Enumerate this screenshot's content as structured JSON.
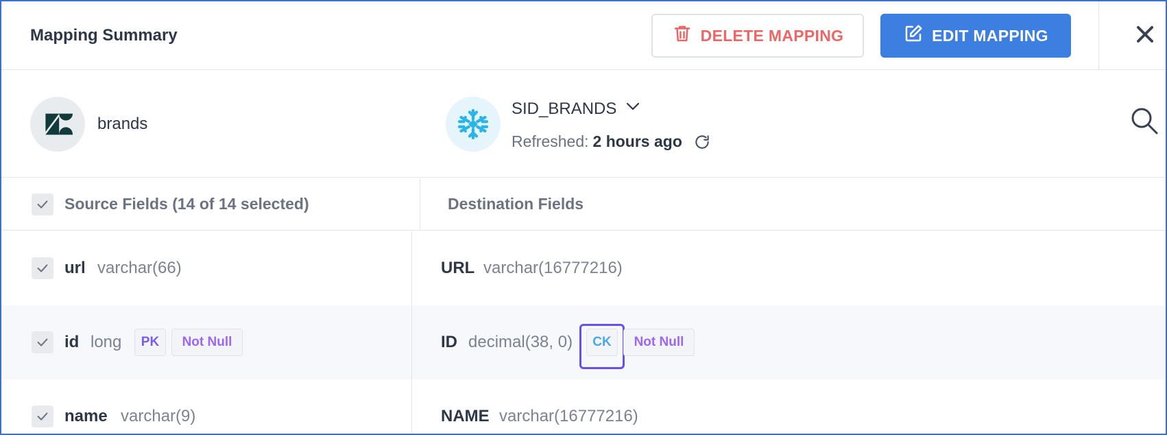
{
  "header": {
    "title": "Mapping Summary",
    "delete_label": "DELETE MAPPING",
    "edit_label": "EDIT MAPPING"
  },
  "source": {
    "name": "brands",
    "icon": "zendesk-logo"
  },
  "destination": {
    "name": "SID_BRANDS",
    "icon": "snowflake-logo",
    "refreshed_label": "Refreshed:",
    "refreshed_value": "2 hours ago"
  },
  "columns": {
    "source_header": "Source Fields (14 of 14 selected)",
    "destination_header": "Destination Fields"
  },
  "rows": [
    {
      "source_name": "url",
      "source_type": "varchar(66)",
      "source_badges": [],
      "dest_name": "URL",
      "dest_type": "varchar(16777216)",
      "dest_badges": []
    },
    {
      "source_name": "id",
      "source_type": "long",
      "source_badges": [
        "PK",
        "Not Null"
      ],
      "dest_name": "ID",
      "dest_type": "decimal(38, 0)",
      "dest_badges": [
        "CK",
        "Not Null"
      ]
    },
    {
      "source_name": "name",
      "source_type": "varchar(9)",
      "source_badges": [],
      "dest_name": "NAME",
      "dest_type": "varchar(16777216)",
      "dest_badges": []
    }
  ],
  "colors": {
    "accent": "#3d7fe0",
    "danger": "#e96767",
    "badge_purple": "#9b67f6",
    "badge_blue": "#4aa8ea",
    "focus_outline": "#6a4ef0"
  }
}
